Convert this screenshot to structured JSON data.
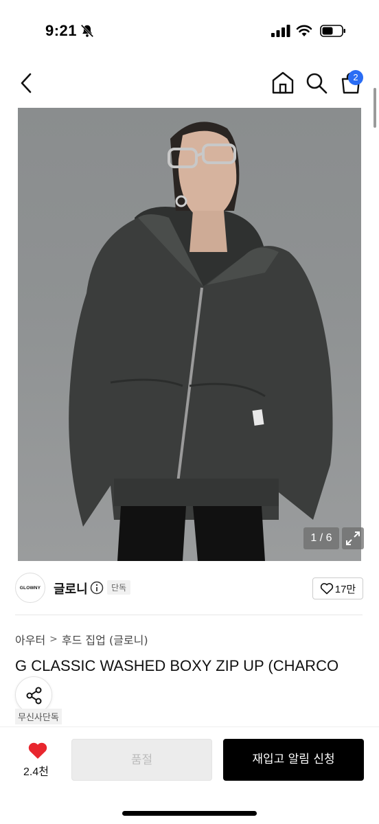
{
  "status_bar": {
    "time": "9:21"
  },
  "header": {
    "cart_count": "2"
  },
  "gallery": {
    "counter": "1 / 6"
  },
  "brand": {
    "logo_text": "GLOWNY",
    "name": "글로니",
    "exclusive_tag": "단독",
    "likes": "17만"
  },
  "product": {
    "breadcrumb": [
      "아우터",
      "후드 집업 (글로니)"
    ],
    "title": "G CLASSIC WASHED BOXY ZIP UP (CHARCO",
    "tag": "무신사단독"
  },
  "bottom_bar": {
    "wish_count": "2.4천",
    "soldout_label": "품절",
    "restock_label": "재입고 알림 신청"
  },
  "colors": {
    "accent": "#2a6df4",
    "heart": "#e8262e",
    "primary_button": "#000000"
  },
  "icons": [
    "bell-off-icon",
    "signal-icon",
    "wifi-icon",
    "battery-icon",
    "back-icon",
    "home-icon",
    "search-icon",
    "cart-icon",
    "expand-icon",
    "info-icon",
    "heart-outline-icon",
    "share-icon",
    "heart-filled-icon"
  ]
}
